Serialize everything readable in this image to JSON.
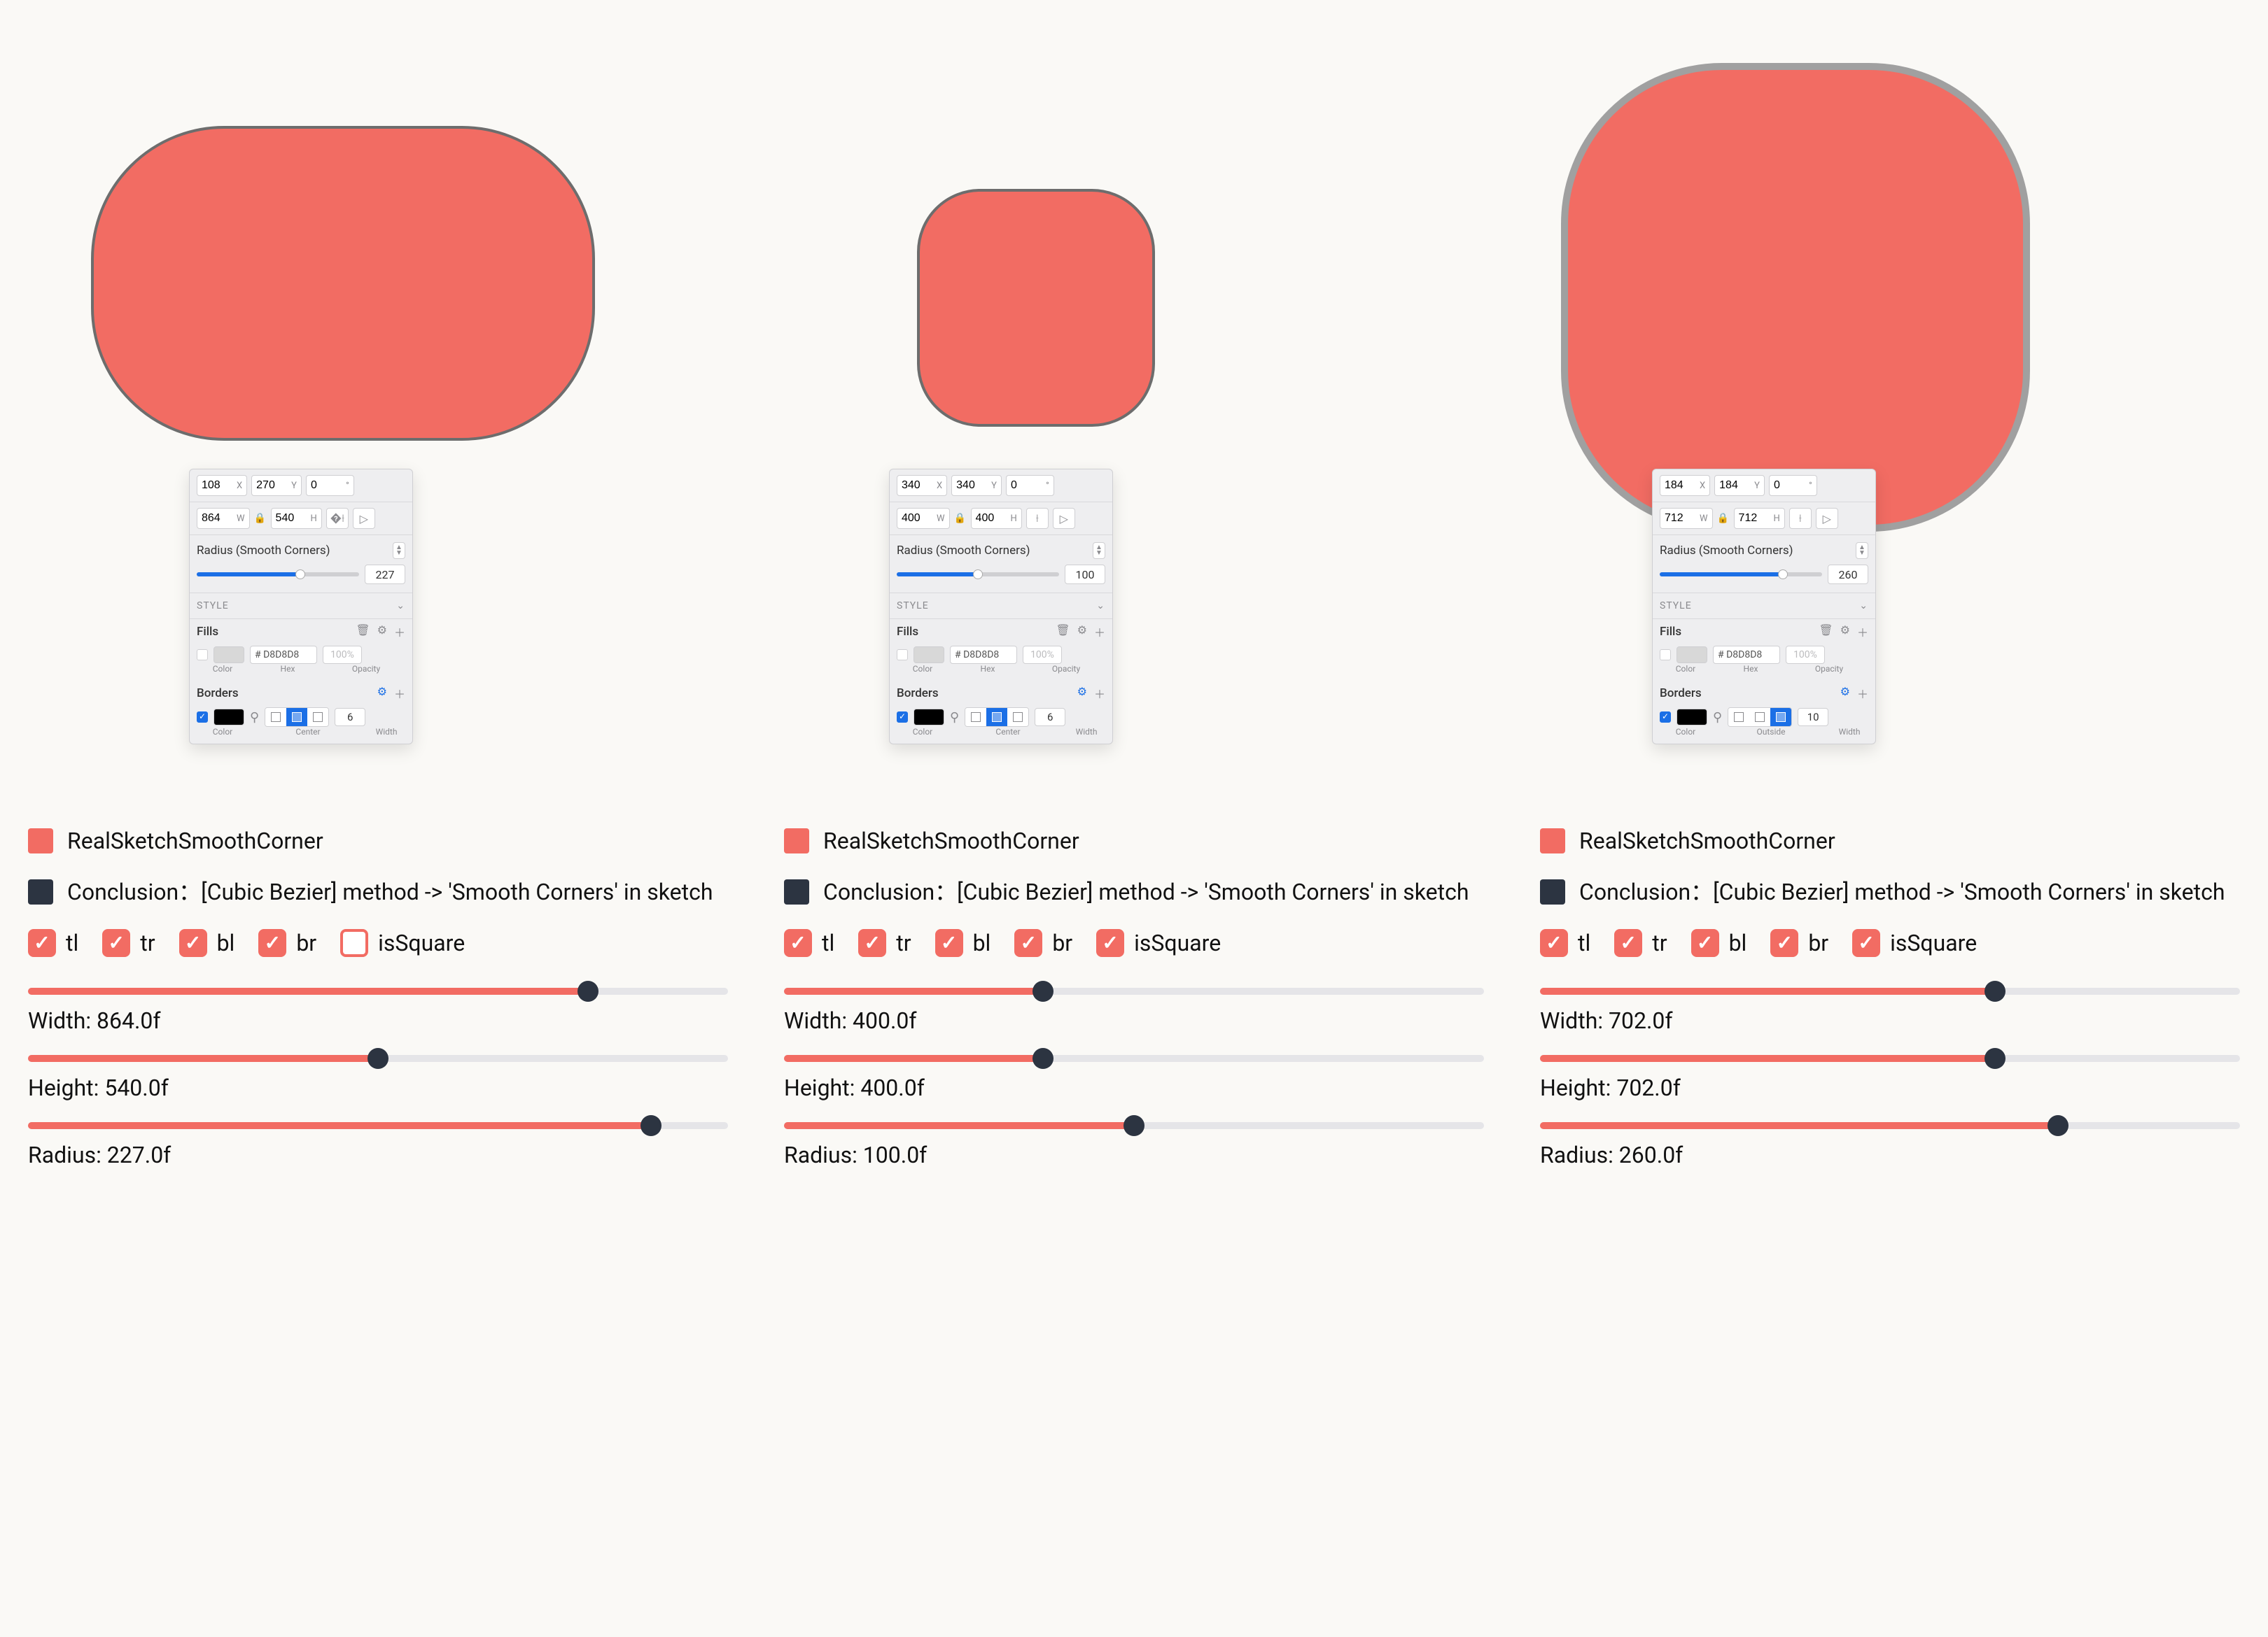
{
  "legend": {
    "real_label": "RealSketchSmoothCorner",
    "conclusion_label": "Conclusion：[Cubic Bezier] method -> 'Smooth Corners' in sketch"
  },
  "checks": {
    "tl": "tl",
    "tr": "tr",
    "bl": "bl",
    "br": "br",
    "isSquare": "isSquare"
  },
  "inspector_common": {
    "radius_label": "Radius (Smooth Corners)",
    "style_label": "STYLE",
    "fills_label": "Fills",
    "borders_label": "Borders",
    "hex_value": "# D8D8D8",
    "opacity_value": "100%",
    "color_label": "Color",
    "hex_label": "Hex",
    "opacity_label": "Opacity",
    "width_label": "Width",
    "x_label": "X",
    "y_label": "Y",
    "w_label": "W",
    "h_label": "H",
    "angle_value": "0"
  },
  "panels": [
    {
      "x": "108",
      "y": "270",
      "w": "864",
      "h": "540",
      "radius": "227",
      "radius_fill_pct": 64,
      "border_pos_label": "Center",
      "border_pos_active": 1,
      "border_width": "6",
      "isSquare_checked": false,
      "slider_width_label": "Width: 864.0f",
      "slider_width_pct": 80,
      "slider_height_label": "Height: 540.0f",
      "slider_height_pct": 50,
      "slider_radius_label": "Radius: 227.0f",
      "slider_radius_pct": 89
    },
    {
      "x": "340",
      "y": "340",
      "w": "400",
      "h": "400",
      "radius": "100",
      "radius_fill_pct": 50,
      "border_pos_label": "Center",
      "border_pos_active": 1,
      "border_width": "6",
      "isSquare_checked": true,
      "slider_width_label": "Width: 400.0f",
      "slider_width_pct": 37,
      "slider_height_label": "Height: 400.0f",
      "slider_height_pct": 37,
      "slider_radius_label": "Radius: 100.0f",
      "slider_radius_pct": 50
    },
    {
      "x": "184",
      "y": "184",
      "w": "712",
      "h": "712",
      "radius": "260",
      "radius_fill_pct": 76,
      "border_pos_label": "Outside",
      "border_pos_active": 2,
      "border_width": "10",
      "isSquare_checked": true,
      "slider_width_label": "Width: 702.0f",
      "slider_width_pct": 65,
      "slider_height_label": "Height: 702.0f",
      "slider_height_pct": 65,
      "slider_radius_label": "Radius: 260.0f",
      "slider_radius_pct": 74
    }
  ]
}
